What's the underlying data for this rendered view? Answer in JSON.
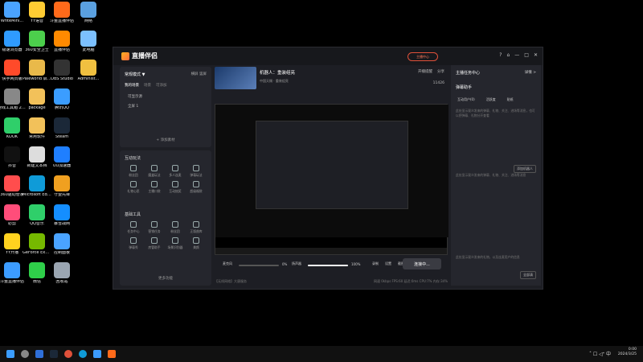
{
  "desktop_icons": [
    {
      "label": "WriteMini...",
      "color": "#4aa3ff"
    },
    {
      "label": "YY语音",
      "color": "#ffcc33"
    },
    {
      "label": "斗鱼直播伴侣",
      "color": "#ff6a1a"
    },
    {
      "label": "网络",
      "color": "#5aa0e0"
    },
    {
      "label": "极速浏览器",
      "color": "#2f9bff"
    },
    {
      "label": "360安全卫士",
      "color": "#4ccf4c"
    },
    {
      "label": "直播伴侣",
      "color": "#ff8a00"
    },
    {
      "label": "此电脑",
      "color": "#7cc0ff"
    },
    {
      "label": "快手网页版",
      "color": "#ff4a2a"
    },
    {
      "label": "Paleworld 启动助手",
      "color": "#e9b94a"
    },
    {
      "label": "OBS Studio",
      "color": "#333333"
    },
    {
      "label": "Administ...",
      "color": "#f0c040"
    },
    {
      "label": "游戏工具箱 2023",
      "color": "#888888"
    },
    {
      "label": "package",
      "color": "#f2c15a"
    },
    {
      "label": "腾讯QQ",
      "color": "#3b9dff"
    },
    {
      "label": "KOOK",
      "color": "#2fcf6a"
    },
    {
      "label": "常用软件",
      "color": "#f2c15a"
    },
    {
      "label": "Steam",
      "color": "#1b2838"
    },
    {
      "label": "抖音",
      "color": "#111111"
    },
    {
      "label": "新建文本档",
      "color": "#dddddd"
    },
    {
      "label": "UU加速器",
      "color": "#1f7fff"
    },
    {
      "label": "360驱动管家",
      "color": "#ff4d4d"
    },
    {
      "label": "Microsoft Edge",
      "color": "#0f9bd8"
    },
    {
      "label": "守望先锋",
      "color": "#f0a020"
    },
    {
      "label": "必剪",
      "color": "#ff4d7a"
    },
    {
      "label": "QQ音乐",
      "color": "#2fcf6a"
    },
    {
      "label": "暴雪战网",
      "color": "#148eff"
    },
    {
      "label": "YY开播",
      "color": "#ffd21f"
    },
    {
      "label": "GeForce Experience",
      "color": "#76b900"
    },
    {
      "label": "控制面板",
      "color": "#4aa3ff"
    },
    {
      "label": "斗鱼直播伴侣",
      "color": "#3c9cff"
    },
    {
      "label": "微信",
      "color": "#2fcf4a"
    },
    {
      "label": "回收站",
      "color": "#9aa5b1"
    }
  ],
  "app": {
    "logo": "直播伴侣",
    "live_center_badge": "主播中心",
    "window_controls": [
      "?",
      "⌂",
      "—",
      "□",
      "✕"
    ]
  },
  "left": {
    "mode": "常规模式 ▼",
    "mode_right": "横屏 竖屏",
    "tabs": [
      "我的场景",
      "场景",
      "可添加"
    ],
    "sources": [
      "可显示源",
      "全屏 1"
    ],
    "add_source": "+ 添加素材",
    "interactive_title": "互动玩法",
    "interactive": [
      "粉丝团",
      "魔盒玩法",
      "多人连麦",
      "弹幕玩法",
      "礼物心愿",
      "主播口袋",
      "互动抽奖",
      "超级福袋"
    ],
    "basic_title": "基础工具",
    "basic": [
      "任务中心",
      "营销任务",
      "粉丝团",
      "正版曲库",
      "弹幕秀",
      "房管助手",
      "场景识别器",
      "美颜"
    ],
    "more": "更多功能"
  },
  "center": {
    "stream_title": "机器人：重装组亮",
    "stream_sub": "中国天赐 · 重装组亮",
    "stats": "11426",
    "top_info": [
      "开播提醒",
      "分享"
    ],
    "controls": {
      "mic": "麦克风",
      "mic_vol": "0%",
      "speaker": "扬声器",
      "speaker_vol": "100%",
      "record": "录制",
      "settings": "设置",
      "clip": "截图"
    },
    "live_button": "连接中...",
    "status_left": "【无线网络】大唐服务",
    "status_right": "网速 0kbps   FPS:60   延迟:0ms   CPU:7%   内存:34%"
  },
  "right": {
    "head": "主播任务中心",
    "head_link": "详情 >",
    "title": "弹幕助手",
    "tabs": [
      "互动用户(0)",
      "活跃度",
      "贴纸"
    ],
    "text1": "此处显示观众发来的弹幕、礼物、关注、进场等消息，也可以把弹幕、礼物分开查看",
    "text2": "此处显示观众发来的弹幕、礼物、关注、进场等消息",
    "text3": "此处显示观众发来的礼物，以及连麦用户的信息",
    "btn1": "添加机器人",
    "btn2": "全部清"
  },
  "taskbar": {
    "time": "0:00",
    "date": "2024/3/25",
    "tray": "ˆ  ☐  ◁ᐩ  中"
  }
}
